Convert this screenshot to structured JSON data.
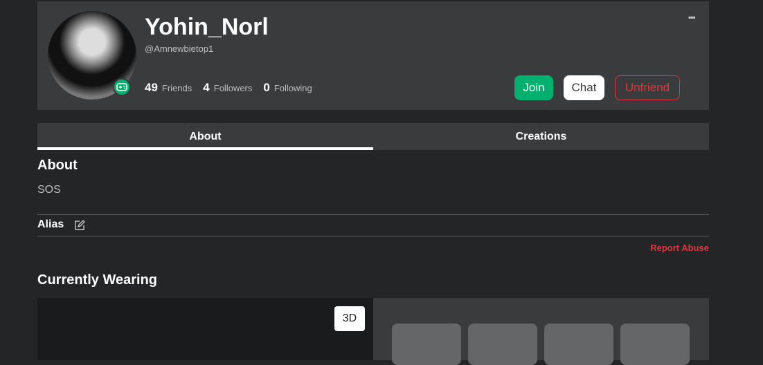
{
  "profile": {
    "display_name": "Yohin_Norl",
    "username": "@Amnewbietop1",
    "stats": [
      {
        "count": "49",
        "label": "Friends"
      },
      {
        "count": "4",
        "label": "Followers"
      },
      {
        "count": "0",
        "label": "Following"
      }
    ],
    "buttons": {
      "join": "Join",
      "chat": "Chat",
      "unfriend": "Unfriend"
    },
    "more": "▪▪▪"
  },
  "tabs": [
    {
      "label": "About"
    },
    {
      "label": "Creations"
    }
  ],
  "about": {
    "heading": "About",
    "text": "SOS",
    "alias_label": "Alias",
    "report": "Report Abuse"
  },
  "wearing": {
    "heading": "Currently Wearing",
    "btn_3d": "3D"
  },
  "colors": {
    "accent": "#00b06f",
    "danger": "#e5343d"
  }
}
